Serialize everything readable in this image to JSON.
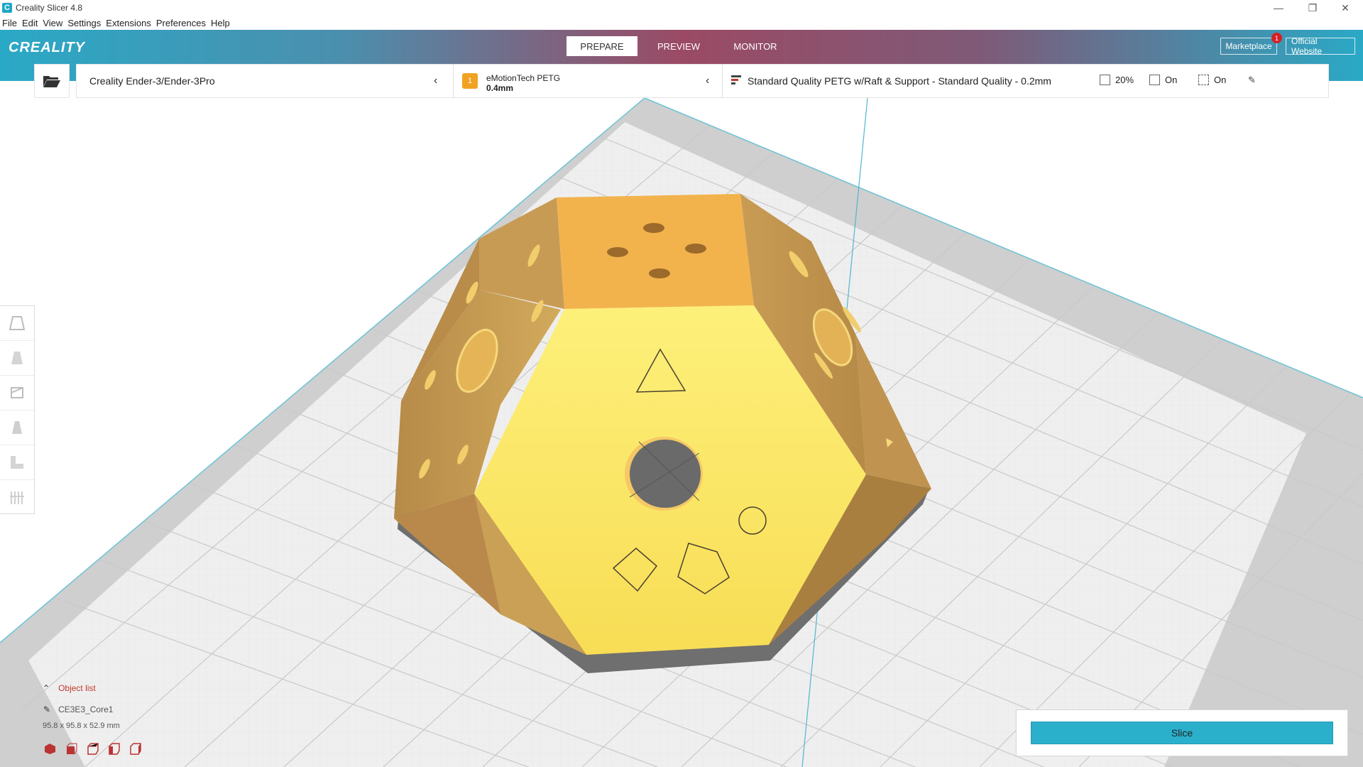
{
  "window": {
    "title": "Creality Slicer 4.8",
    "icon": "C"
  },
  "window_controls": {
    "minimize": "—",
    "maximize": "❐",
    "close": "✕"
  },
  "menu": [
    "File",
    "Edit",
    "View",
    "Settings",
    "Extensions",
    "Preferences",
    "Help"
  ],
  "header": {
    "logo": "CREALITY",
    "stages": [
      "PREPARE",
      "PREVIEW",
      "MONITOR"
    ],
    "active_stage": "PREPARE",
    "marketplace_label": "Marketplace",
    "marketplace_badge": "1",
    "website_label": "Official Website"
  },
  "config": {
    "printer": "Creality Ender-3/Ender-3Pro",
    "material_index": "1",
    "material_name": "eMotionTech PETG",
    "nozzle": "0.4mm",
    "profile": "Standard Quality PETG w/Raft & Support - Standard Quality - 0.2mm",
    "infill": "20%",
    "support": "On",
    "adhesion": "On"
  },
  "object_list": {
    "title": "Object list",
    "object_name": "CE3E3_Core1",
    "dimensions": "95.8 x 95.8 x 52.9 mm"
  },
  "slice": {
    "label": "Slice"
  },
  "colors": {
    "accent": "#2bb0cc",
    "model_top": "#f3b34c",
    "model_front": "#fbe76a",
    "model_side": "#c9a055"
  },
  "icons": {
    "open": "folder-open-icon",
    "tools": [
      "move-tool-icon",
      "scale-tool-icon",
      "rotate-tool-icon",
      "mirror-tool-icon",
      "per-model-settings-icon",
      "support-blocker-icon"
    ],
    "views": [
      "3d-view-icon",
      "front-view-icon",
      "top-view-icon",
      "left-view-icon",
      "right-view-icon"
    ]
  }
}
